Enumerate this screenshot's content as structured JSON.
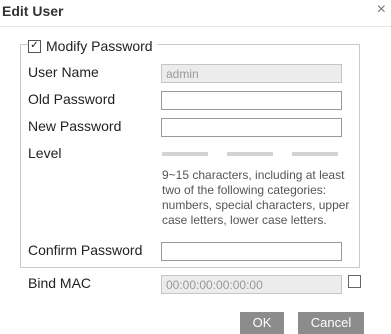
{
  "dialog": {
    "title": "Edit User",
    "close_icon": "close-icon ×"
  },
  "modify_password": {
    "checked": true,
    "label": "Modify Password"
  },
  "fields": {
    "user_name": {
      "label": "User Name",
      "value": "admin"
    },
    "old_password": {
      "label": "Old Password",
      "value": ""
    },
    "new_password": {
      "label": "New Password",
      "value": ""
    },
    "level": {
      "label": "Level"
    },
    "confirm_password": {
      "label": "Confirm Password",
      "value": ""
    },
    "bind_mac": {
      "label": "Bind MAC",
      "value": "00:00:00:00:00:00",
      "checked": false
    }
  },
  "hint": "9~15 characters, including at least two of the following categories: numbers, special characters, upper case letters, lower case letters.",
  "buttons": {
    "ok": "OK",
    "cancel": "Cancel"
  }
}
